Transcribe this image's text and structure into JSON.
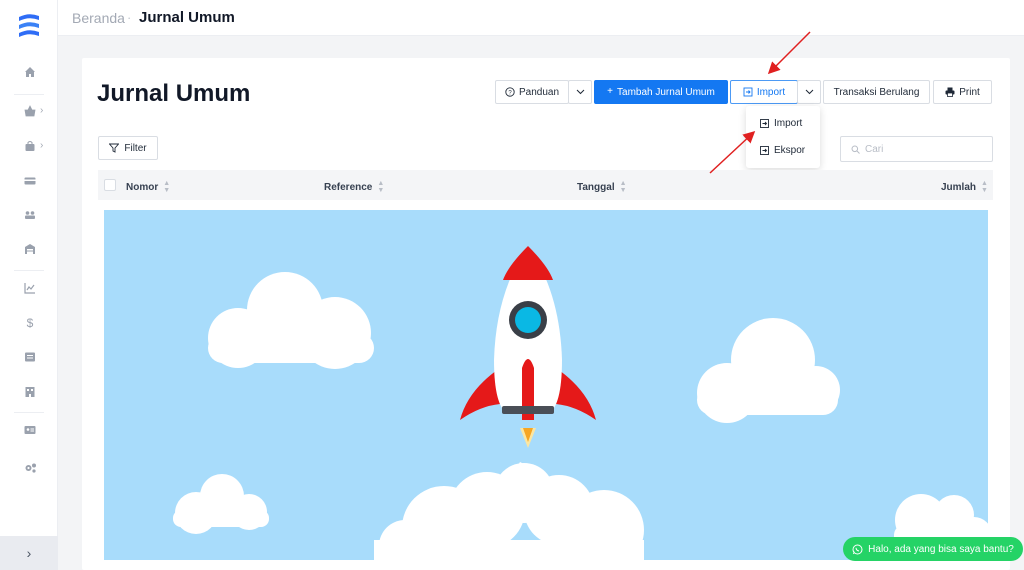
{
  "breadcrumb": {
    "root": "Beranda",
    "separator": "·",
    "current": "Jurnal Umum"
  },
  "page": {
    "title": "Jurnal Umum"
  },
  "toolbar": {
    "guide_label": "Panduan",
    "add_label": "Tambah Jurnal Umum",
    "import_label": "Import",
    "recurring_label": "Transaksi Berulang",
    "print_label": "Print"
  },
  "import_menu": {
    "items": [
      {
        "label": "Import"
      },
      {
        "label": "Ekspor"
      }
    ]
  },
  "filter": {
    "label": "Filter"
  },
  "search": {
    "placeholder": "Cari"
  },
  "table": {
    "columns": [
      "Nomor",
      "Reference",
      "Tanggal",
      "Jumlah"
    ]
  },
  "chat": {
    "label": "Halo, ada yang bisa saya bantu?"
  },
  "sidebar": {
    "icons": [
      "home-icon",
      "basket-icon",
      "bag-icon",
      "card-icon",
      "group-icon",
      "warehouse-icon",
      "chart-icon",
      "dollar-icon",
      "list-icon",
      "building-icon",
      "contact-icon",
      "settings-icon"
    ]
  },
  "colors": {
    "primary": "#1478f2",
    "sky": "#a8dcfb",
    "whatsapp": "#25d366",
    "annotation": "#e02020"
  }
}
